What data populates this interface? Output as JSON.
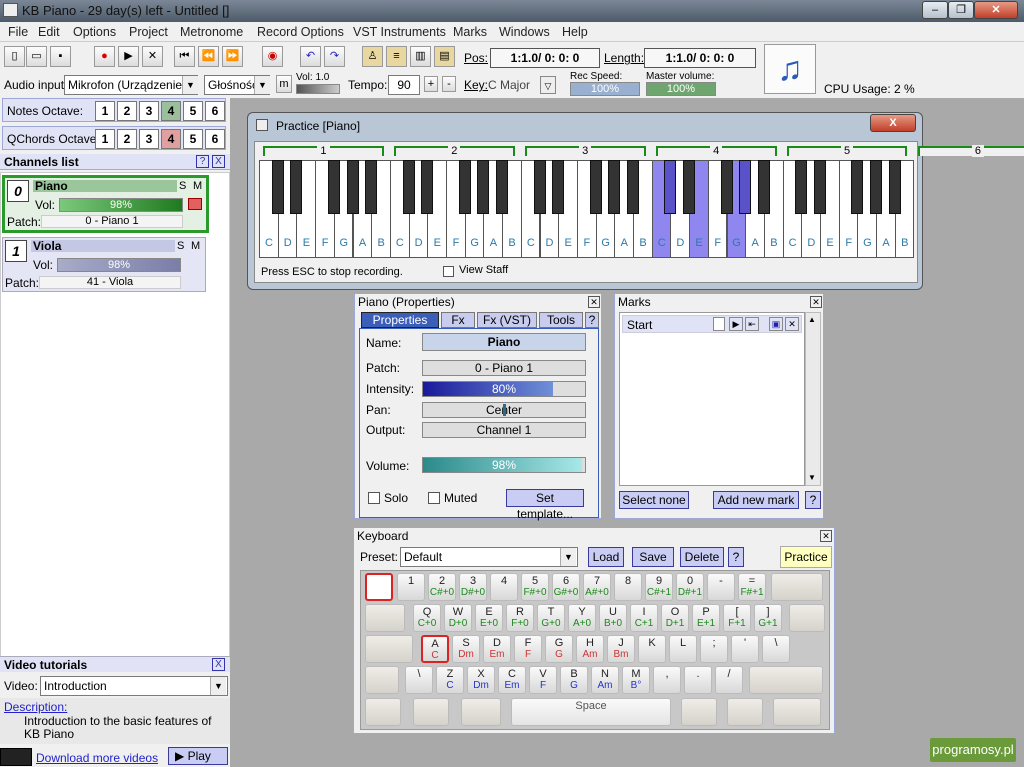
{
  "window": {
    "title": "KB Piano - 29 day(s) left - Untitled []"
  },
  "menu": [
    "File",
    "Edit",
    "Options",
    "Project",
    "Metronome",
    "Record Options",
    "VST Instruments",
    "Marks",
    "Windows",
    "Help"
  ],
  "toolbar": {
    "pos_label": "Pos:",
    "pos_value": "1:1.0/ 0: 0: 0",
    "length_label": "Length:",
    "length_value": "1:1.0/ 0: 0: 0",
    "audio_input_label": "Audio input:",
    "audio_input_value": "Mikrofon (Urządzenie zg",
    "volume_select": "Głośność",
    "m_button": "m",
    "vol_label": "Vol: 1.0",
    "tempo_label": "Tempo:",
    "tempo_value": "90",
    "plus": "+",
    "minus": "-",
    "key_label": "Key:",
    "key_value": "C Major",
    "rec_speed_label": "Rec Speed:",
    "rec_speed_value": "100%",
    "master_volume_label": "Master volume:",
    "master_volume_value": "100%",
    "cpu_usage": "CPU Usage: 2 %"
  },
  "notes_octave": {
    "label": "Notes Octave:",
    "options": [
      "1",
      "2",
      "3",
      "4",
      "5",
      "6"
    ],
    "selected": "4"
  },
  "qchords_octave": {
    "label": "QChords Octave:",
    "options": [
      "1",
      "2",
      "3",
      "4",
      "5",
      "6"
    ],
    "selected": "4"
  },
  "channels": {
    "title": "Channels list",
    "help": "?",
    "close": "X",
    "items": [
      {
        "num": "0",
        "name": "Piano",
        "s": "S",
        "m": "M",
        "vol_label": "Vol:",
        "vol": "98%",
        "vol_level": 0.98,
        "patch_label": "Patch:",
        "patch": "0 - Piano 1"
      },
      {
        "num": "1",
        "name": "Viola",
        "s": "S",
        "m": "M",
        "vol_label": "Vol:",
        "vol": "98%",
        "vol_level": 0.98,
        "patch_label": "Patch:",
        "patch": "41 - Viola"
      }
    ]
  },
  "video": {
    "title": "Video tutorials",
    "close": "X",
    "video_label": "Video:",
    "video_value": "Introduction",
    "description_label": "Description:",
    "description": "Introduction to the basic features of KB Piano",
    "download": "Download more videos",
    "play": "Play"
  },
  "practice": {
    "title": "Practice [Piano]",
    "close": "X",
    "octaves": [
      "1",
      "2",
      "3",
      "4",
      "5",
      "6"
    ],
    "notes": [
      "C",
      "D",
      "E",
      "F",
      "G",
      "A",
      "B"
    ],
    "status": "Press ESC to stop recording.",
    "view_staff": "View Staff",
    "highlight": {
      "white": [
        21,
        23,
        25
      ],
      "black": [
        15,
        18
      ]
    }
  },
  "properties": {
    "title": "Piano (Properties)",
    "tabs": [
      "Properties",
      "Fx",
      "Fx (VST)",
      "Tools",
      "?"
    ],
    "name_label": "Name:",
    "name": "Piano",
    "patch_label": "Patch:",
    "patch": "0 - Piano 1",
    "intensity_label": "Intensity:",
    "intensity": "80%",
    "intensity_level": 0.8,
    "pan_label": "Pan:",
    "pan": "Center",
    "output_label": "Output:",
    "output": "Channel 1",
    "volume_label": "Volume:",
    "volume": "98%",
    "volume_level": 0.98,
    "solo": "Solo",
    "muted": "Muted",
    "set_template": "Set template..."
  },
  "marks": {
    "title": "Marks",
    "items": [
      "Start"
    ],
    "select_none": "Select none",
    "add_new_mark": "Add new mark",
    "help": "?"
  },
  "keyboard": {
    "title": "Keyboard",
    "preset_label": "Preset:",
    "preset_value": "Default",
    "load": "Load",
    "save": "Save",
    "delete": "Delete",
    "help": "?",
    "practice": "Practice",
    "row1": [
      [
        "1",
        ""
      ],
      [
        "2",
        "C#+0"
      ],
      [
        "3",
        "D#+0"
      ],
      [
        "4",
        ""
      ],
      [
        "5",
        "F#+0"
      ],
      [
        "6",
        "G#+0"
      ],
      [
        "7",
        "A#+0"
      ],
      [
        "8",
        ""
      ],
      [
        "9",
        "C#+1"
      ],
      [
        "0",
        "D#+1"
      ],
      [
        "-",
        ""
      ],
      [
        "=",
        "F#+1"
      ]
    ],
    "row2": [
      [
        "Q",
        "C+0"
      ],
      [
        "W",
        "D+0"
      ],
      [
        "E",
        "E+0"
      ],
      [
        "R",
        "F+0"
      ],
      [
        "T",
        "G+0"
      ],
      [
        "Y",
        "A+0"
      ],
      [
        "U",
        "B+0"
      ],
      [
        "I",
        "C+1"
      ],
      [
        "O",
        "D+1"
      ],
      [
        "P",
        "E+1"
      ],
      [
        "[",
        "F+1"
      ],
      [
        "]",
        "G+1"
      ]
    ],
    "row3": [
      [
        "A",
        "C"
      ],
      [
        "S",
        "Dm"
      ],
      [
        "D",
        "Em"
      ],
      [
        "F",
        "F"
      ],
      [
        "G",
        "G"
      ],
      [
        "H",
        "Am"
      ],
      [
        "J",
        "Bm"
      ],
      [
        "K",
        ""
      ],
      [
        "L",
        ""
      ],
      [
        ";",
        ""
      ],
      [
        "'",
        ""
      ],
      [
        "\\",
        ""
      ]
    ],
    "row4": [
      [
        "\\",
        ""
      ],
      [
        "Z",
        "C"
      ],
      [
        "X",
        "Dm"
      ],
      [
        "C",
        "Em"
      ],
      [
        "V",
        "F"
      ],
      [
        "B",
        "G"
      ],
      [
        "N",
        "Am"
      ],
      [
        "M",
        "B°"
      ],
      [
        ",",
        ""
      ],
      [
        ".",
        ""
      ],
      [
        "/",
        ""
      ]
    ],
    "space": "Space"
  },
  "watermark": "programosy.pl"
}
